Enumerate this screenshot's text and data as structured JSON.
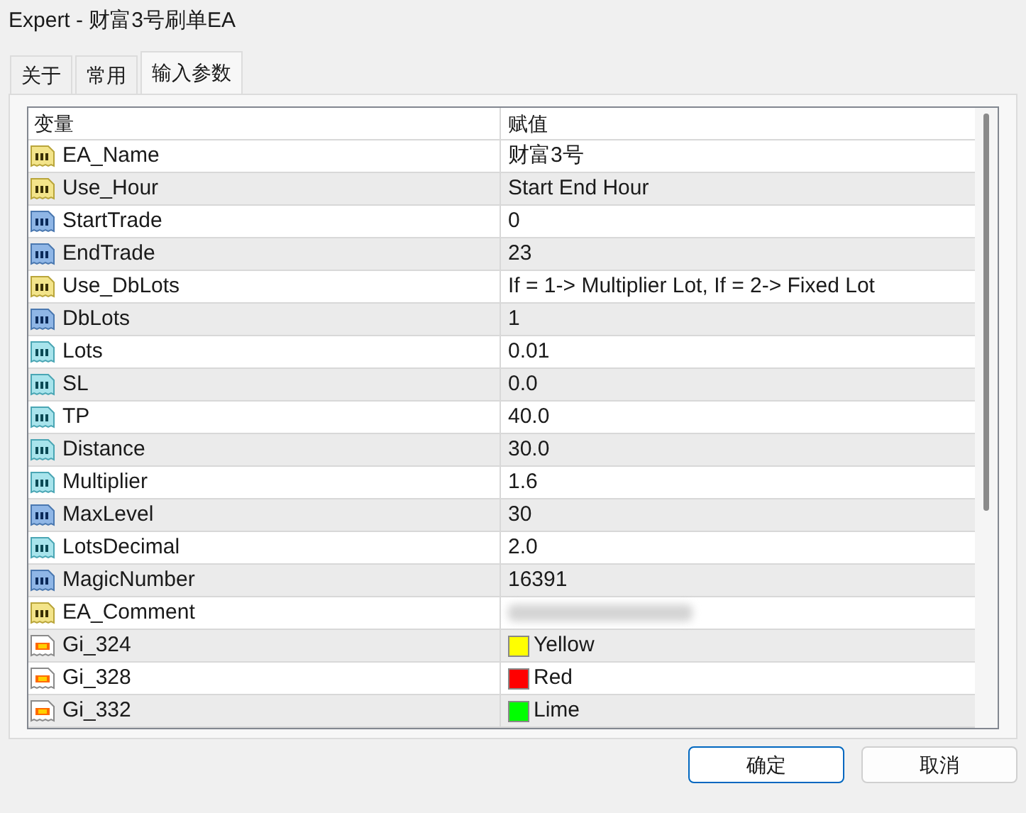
{
  "window": {
    "title": "Expert - 财富3号刷单EA"
  },
  "tabs": [
    {
      "label": "关于",
      "selected": false
    },
    {
      "label": "常用",
      "selected": false
    },
    {
      "label": "输入参数",
      "selected": true
    }
  ],
  "table": {
    "columns": [
      "变量",
      "赋值"
    ],
    "rows": [
      {
        "kind": "string",
        "name": "EA_Name",
        "value": "财富3号"
      },
      {
        "kind": "string",
        "name": "Use_Hour",
        "value": "Start End Hour"
      },
      {
        "kind": "int",
        "name": "StartTrade",
        "value": "0"
      },
      {
        "kind": "int",
        "name": "EndTrade",
        "value": "23"
      },
      {
        "kind": "string",
        "name": "Use_DbLots",
        "value": "If = 1-> Multiplier Lot, If = 2-> Fixed Lot"
      },
      {
        "kind": "int",
        "name": "DbLots",
        "value": "1"
      },
      {
        "kind": "double",
        "name": "Lots",
        "value": "0.01"
      },
      {
        "kind": "double",
        "name": "SL",
        "value": "0.0"
      },
      {
        "kind": "double",
        "name": "TP",
        "value": "40.0"
      },
      {
        "kind": "double",
        "name": "Distance",
        "value": "30.0"
      },
      {
        "kind": "double",
        "name": "Multiplier",
        "value": "1.6"
      },
      {
        "kind": "int",
        "name": "MaxLevel",
        "value": "30"
      },
      {
        "kind": "double",
        "name": "LotsDecimal",
        "value": "2.0"
      },
      {
        "kind": "int",
        "name": "MagicNumber",
        "value": "16391"
      },
      {
        "kind": "string",
        "name": "EA_Comment"
      },
      {
        "kind": "color",
        "name": "Gi_324",
        "value": "Yellow",
        "color": "#ffff00"
      },
      {
        "kind": "color",
        "name": "Gi_328",
        "value": "Red",
        "color": "#ff0000"
      },
      {
        "kind": "color",
        "name": "Gi_332",
        "value": "Lime",
        "color": "#00ff00"
      }
    ]
  },
  "buttons": [
    "确定",
    "取消"
  ]
}
